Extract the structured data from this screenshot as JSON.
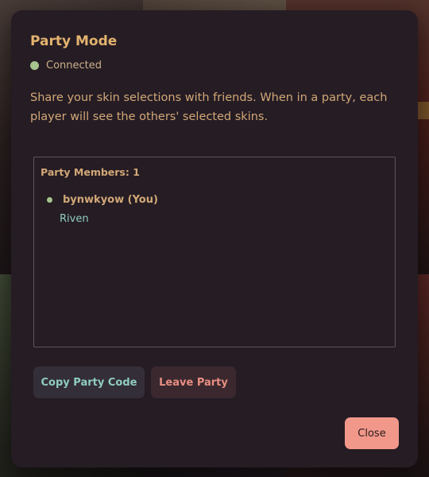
{
  "modal": {
    "title": "Party Mode",
    "status": {
      "label": "Connected",
      "color": "#a7c58f"
    },
    "description": "Share your skin selections with friends. When in a party, each player will see the others' selected skins.",
    "members_header": "Party Members: 1",
    "members": [
      {
        "name": "bynwkyow (You)",
        "skin": "Riven"
      }
    ],
    "buttons": {
      "copy_code": "Copy Party Code",
      "leave": "Leave Party",
      "close": "Close"
    }
  },
  "colors": {
    "modal_background": "#251c24",
    "title": "#e3b36e",
    "accent_teal": "#8fcdbf",
    "danger": "#e88e82",
    "close_button": "#f1988a"
  }
}
